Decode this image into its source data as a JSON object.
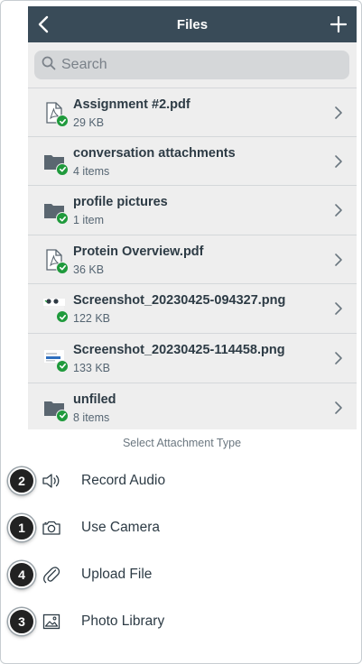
{
  "navbar": {
    "title": "Files",
    "back_icon": "chevron-left-icon",
    "add_icon": "plus-icon"
  },
  "search": {
    "placeholder": "Search",
    "value": ""
  },
  "files": [
    {
      "name": "Assignment #2.pdf",
      "meta": "29 KB",
      "icon": "pdf-file-icon"
    },
    {
      "name": "conversation attachments",
      "meta": "4 items",
      "icon": "folder-icon"
    },
    {
      "name": "profile pictures",
      "meta": "1 item",
      "icon": "folder-icon"
    },
    {
      "name": "Protein Overview.pdf",
      "meta": "36 KB",
      "icon": "pdf-file-icon"
    },
    {
      "name": "Screenshot_20230425-094327.png",
      "meta": "122 KB",
      "icon": "image-thumbnail-icon"
    },
    {
      "name": "Screenshot_20230425-114458.png",
      "meta": "133 KB",
      "icon": "image-thumbnail-icon"
    },
    {
      "name": "unfiled",
      "meta": "8 items",
      "icon": "folder-icon"
    }
  ],
  "sheet": {
    "title": "Select Attachment Type",
    "options": [
      {
        "step": "2",
        "label": "Record Audio",
        "icon": "speaker-icon"
      },
      {
        "step": "1",
        "label": "Use Camera",
        "icon": "camera-icon"
      },
      {
        "step": "4",
        "label": "Upload File",
        "icon": "paperclip-icon"
      },
      {
        "step": "3",
        "label": "Photo Library",
        "icon": "photo-icon"
      }
    ]
  },
  "colors": {
    "navbar": "#394b58",
    "synced_badge": "#1f9a3c",
    "text": "#2d3b45"
  }
}
